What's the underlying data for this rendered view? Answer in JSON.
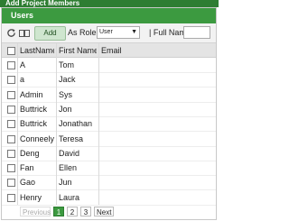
{
  "window_title": "Add Project Members",
  "panel_title": "Users",
  "toolbar": {
    "refresh_icon": "refresh-icon",
    "columns_icon": "columns-icon",
    "add_label": "Add",
    "role_label": "As Role:",
    "role_value": "User",
    "fullname_label": "| Full Name:",
    "fullname_value": ""
  },
  "columns": {
    "lastname": "LastName",
    "firstname": "First Name",
    "email": "Email"
  },
  "rows": [
    {
      "lastname": "A",
      "firstname": "Tom",
      "email": ""
    },
    {
      "lastname": "a",
      "firstname": "Jack",
      "email": ""
    },
    {
      "lastname": "Admin",
      "firstname": "Sys",
      "email": ""
    },
    {
      "lastname": "Buttrick",
      "firstname": "Jon",
      "email": ""
    },
    {
      "lastname": "Buttrick",
      "firstname": "Jonathan",
      "email": ""
    },
    {
      "lastname": "Conneely",
      "firstname": "Teresa",
      "email": ""
    },
    {
      "lastname": "Deng",
      "firstname": "David",
      "email": ""
    },
    {
      "lastname": "Fan",
      "firstname": "Ellen",
      "email": ""
    },
    {
      "lastname": "Gao",
      "firstname": "Jun",
      "email": ""
    },
    {
      "lastname": "Henry",
      "firstname": "Laura",
      "email": ""
    }
  ],
  "pager": {
    "previous": "Previous",
    "pages": [
      "1",
      "2",
      "3"
    ],
    "current": "1",
    "next": "Next"
  },
  "colors": {
    "header_green": "#3c9a40",
    "add_button_bg": "#cfe6cf"
  }
}
